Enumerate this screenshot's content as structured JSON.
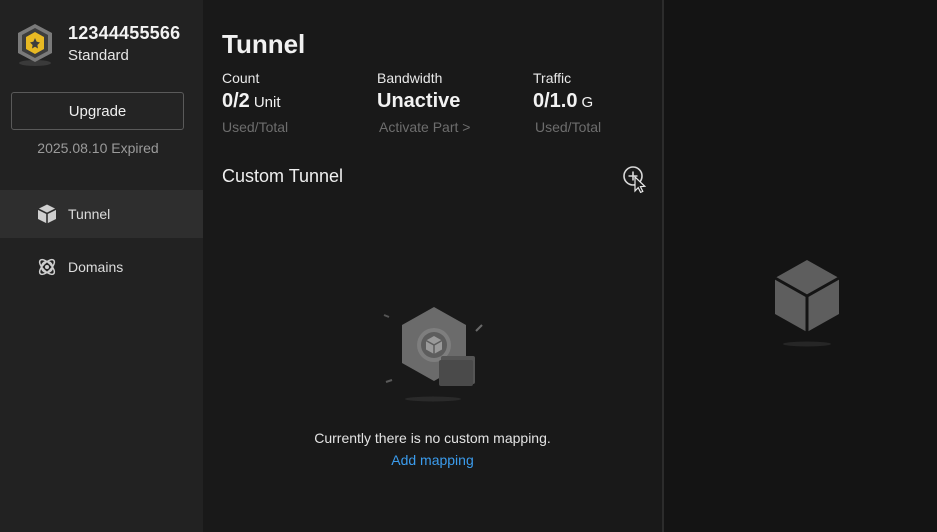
{
  "account": {
    "id": "12344455566",
    "plan": "Standard",
    "upgrade_label": "Upgrade",
    "expiry": "2025.08.10 Expired",
    "badge_icon": "shield-badge-icon"
  },
  "nav": {
    "items": [
      {
        "label": "Tunnel",
        "icon": "cube-icon",
        "active": true
      },
      {
        "label": "Domains",
        "icon": "atom-icon",
        "active": false
      }
    ]
  },
  "main": {
    "title": "Tunnel",
    "stats": {
      "count": {
        "label": "Count",
        "value": "0/2",
        "unit": "Unit",
        "sub": "Used/Total"
      },
      "bandwidth": {
        "label": "Bandwidth",
        "value": "Unactive",
        "sub": "Activate Part >"
      },
      "traffic": {
        "label": "Traffic",
        "value": "0/1.0",
        "unit": "G",
        "sub": "Used/Total"
      }
    },
    "section_title": "Custom Tunnel",
    "empty_message": "Currently there is no custom mapping.",
    "add_link": "Add mapping"
  },
  "colors": {
    "accent": "#3b9ced",
    "badge_gold": "#e8b923",
    "sidebar_bg": "#222222",
    "main_bg": "#191919"
  }
}
